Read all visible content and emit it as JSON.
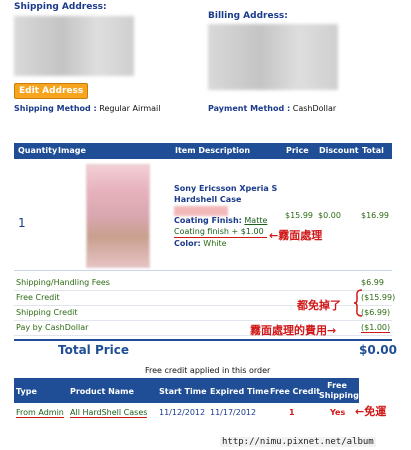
{
  "shipping": {
    "label": "Shipping Address:",
    "method_label": "Shipping Method :",
    "method_value": "Regular Airmail",
    "edit_button": "Edit Address"
  },
  "billing": {
    "label": "Billing Address:",
    "method_label": "Payment Method :",
    "method_value": "CashDollar"
  },
  "order_table": {
    "headers": [
      "Quantity",
      "Image",
      "Item Description",
      "Price",
      "Discount",
      "Total"
    ],
    "row": {
      "quantity": "1",
      "title_line1": "Sony Ericsson Xperia S",
      "title_line2": "Hardshell Case",
      "coating_label": "Coating Finish:",
      "coating_value": "Matte",
      "coating_extra": "Coating finish + $1.00",
      "color_label": "Color:",
      "color_value": "White",
      "price": "$15.99",
      "discount": "$0.00",
      "total": "$16.99"
    }
  },
  "summary": [
    {
      "label": "Shipping/Handling Fees",
      "value": "$6.99"
    },
    {
      "label": "Free Credit",
      "value": "($15.99)"
    },
    {
      "label": "Shipping Credit",
      "value": "($6.99)"
    },
    {
      "label": "Pay by CashDollar",
      "value": "($1.00)"
    }
  ],
  "total_price": {
    "label": "Total Price",
    "value": "$0.00"
  },
  "credit_table": {
    "caption": "Free credit applied in this order",
    "headers": [
      "Type",
      "Product Name",
      "Start Time",
      "Expired Time",
      "Free Credit",
      "Free Shipping"
    ],
    "row": [
      "From Admin",
      "All HardShell Cases",
      "11/12/2012",
      "11/17/2012",
      "1",
      "Yes"
    ]
  },
  "annotations": {
    "matte": "←霧面處理",
    "waived": "都免掉了",
    "matte_fee": "霧面處理的費用→",
    "free_shipping": "←免運"
  },
  "watermark": "http://nimu.pixnet.net/album",
  "colors": {
    "header_blue": "#1f4e96",
    "annotation_red": "#d01818",
    "button_orange": "#f7a51e"
  }
}
